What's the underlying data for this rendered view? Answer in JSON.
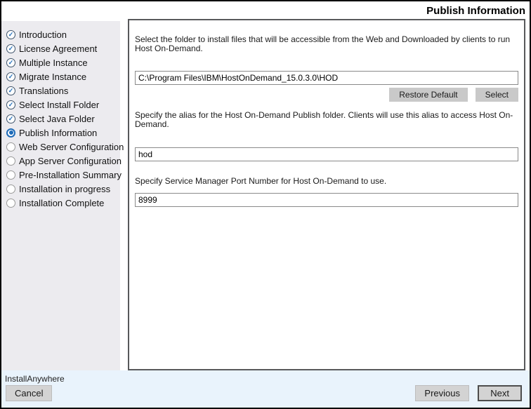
{
  "window": {
    "title": "Publish Information"
  },
  "sidebar": {
    "items": [
      {
        "label": "Introduction",
        "state": "done"
      },
      {
        "label": "License Agreement",
        "state": "done"
      },
      {
        "label": "Multiple Instance",
        "state": "done"
      },
      {
        "label": "Migrate Instance",
        "state": "done"
      },
      {
        "label": "Translations",
        "state": "done"
      },
      {
        "label": "Select Install Folder",
        "state": "done"
      },
      {
        "label": "Select Java Folder",
        "state": "done"
      },
      {
        "label": "Publish Information",
        "state": "current"
      },
      {
        "label": "Web Server Configuration",
        "state": "pending"
      },
      {
        "label": "App Server Configuration",
        "state": "pending"
      },
      {
        "label": "Pre-Installation Summary",
        "state": "pending"
      },
      {
        "label": "Installation in progress",
        "state": "pending"
      },
      {
        "label": "Installation Complete",
        "state": "pending"
      }
    ]
  },
  "main": {
    "folder_section": {
      "instruction": "Select the folder to install files that will be accessible from the Web and Downloaded by clients to run Host On-Demand.",
      "folder_value": "C:\\Program Files\\IBM\\HostOnDemand_15.0.3.0\\HOD",
      "restore_default_label": "Restore Default",
      "select_label": "Select"
    },
    "alias_section": {
      "instruction": "Specify the alias for the Host On-Demand Publish folder. Clients will use this alias to access Host On-Demand.",
      "alias_value": "hod"
    },
    "port_section": {
      "instruction": "Specify Service Manager Port Number for Host On-Demand to use.",
      "port_value": "8999"
    }
  },
  "footer": {
    "brand": "InstallAnywhere",
    "cancel_label": "Cancel",
    "previous_label": "Previous",
    "next_label": "Next"
  },
  "colors": {
    "accent_blue": "#1E6BB8",
    "sidebar_bg": "#ECEBEF",
    "footer_bg": "#E9F3FC",
    "panel_border": "#58595B",
    "button_gray": "#C9C9C9"
  }
}
